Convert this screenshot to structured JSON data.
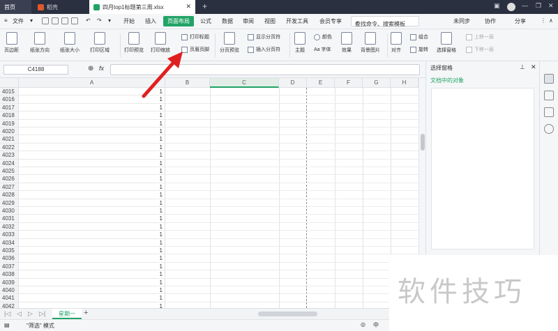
{
  "titlebar": {
    "tabs": [
      {
        "label": "首页"
      },
      {
        "label": "稻壳"
      },
      {
        "label": "四月top1标题第三周.xlsx"
      }
    ]
  },
  "menubar": {
    "file": "文件",
    "items": [
      "开始",
      "插入",
      "页面布局",
      "公式",
      "数据",
      "审阅",
      "视图",
      "开发工具",
      "会员专享"
    ],
    "active": "页面布局",
    "search_placeholder": "查找命令、搜索模板",
    "right": [
      "未同步",
      "协作",
      "分享"
    ]
  },
  "ribbon": {
    "margins": "页边距",
    "orientation": "纸张方向",
    "size": "纸张大小",
    "print_area": "打印区域",
    "print_preview": "打印预览",
    "print_scale": "打印缩放",
    "print_titles": "打印标题",
    "header_footer": "页眉页脚",
    "page_break_preview": "分页预览",
    "show_page_breaks": "显示分页符",
    "insert_page_break": "插入分页符",
    "theme": "主题",
    "colors": "颜色",
    "fonts": "Aa 字体",
    "effects": "效果",
    "background": "背景图片",
    "align": "对齐",
    "group": "组合",
    "rotate": "旋转",
    "selection_pane": "选择窗格",
    "bring_forward": "上移一层",
    "send_backward": "下移一层"
  },
  "formula": {
    "cell_ref": "C4188",
    "fx": "fx"
  },
  "columns": [
    "A",
    "B",
    "C",
    "D",
    "E",
    "F",
    "G",
    "H"
  ],
  "rows": [
    {
      "num": "4015",
      "val": "1"
    },
    {
      "num": "4016",
      "val": "1"
    },
    {
      "num": "4017",
      "val": "1"
    },
    {
      "num": "4018",
      "val": "1"
    },
    {
      "num": "4019",
      "val": "1"
    },
    {
      "num": "4020",
      "val": "1"
    },
    {
      "num": "4021",
      "val": "1"
    },
    {
      "num": "4022",
      "val": "1"
    },
    {
      "num": "4023",
      "val": "1"
    },
    {
      "num": "4024",
      "val": "1"
    },
    {
      "num": "4025",
      "val": "1"
    },
    {
      "num": "4026",
      "val": "1"
    },
    {
      "num": "4027",
      "val": "1"
    },
    {
      "num": "4028",
      "val": "1"
    },
    {
      "num": "4029",
      "val": "1"
    },
    {
      "num": "4030",
      "val": "1"
    },
    {
      "num": "4031",
      "val": "1"
    },
    {
      "num": "4032",
      "val": "1"
    },
    {
      "num": "4033",
      "val": "1"
    },
    {
      "num": "4034",
      "val": "1"
    },
    {
      "num": "4035",
      "val": "1"
    },
    {
      "num": "4036",
      "val": "1"
    },
    {
      "num": "4037",
      "val": "1"
    },
    {
      "num": "4038",
      "val": "1"
    },
    {
      "num": "4039",
      "val": "1"
    },
    {
      "num": "4040",
      "val": "1"
    },
    {
      "num": "4041",
      "val": "1"
    },
    {
      "num": "4042",
      "val": "1"
    }
  ],
  "sheet": {
    "tab": "星期一",
    "add": "+"
  },
  "status": {
    "filter_mode": "\"筛选\" 模式"
  },
  "panel": {
    "title": "选择窗格",
    "subtitle": "文档中的对象"
  },
  "watermark": "软件技巧",
  "colors": {
    "accent": "#21a366",
    "titlebar": "#2b3040",
    "arrow": "#e02020"
  }
}
